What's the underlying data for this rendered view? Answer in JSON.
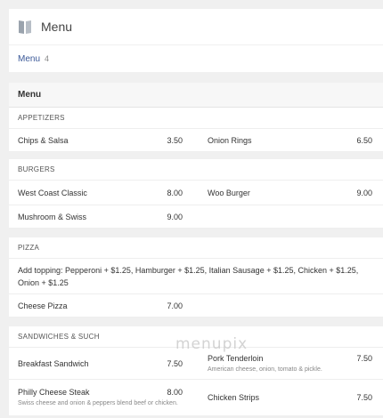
{
  "header": {
    "title": "Menu",
    "icon": "book-icon"
  },
  "breadcrumb": {
    "link": "Menu",
    "count": "4"
  },
  "menu_heading": "Menu",
  "sections": {
    "appetizers": {
      "title": "APPETIZERS",
      "items": [
        {
          "name": "Chips & Salsa",
          "price": "3.50"
        },
        {
          "name": "Onion Rings",
          "price": "6.50"
        }
      ]
    },
    "burgers": {
      "title": "BURGERS",
      "items": [
        {
          "name": "West Coast Classic",
          "price": "8.00"
        },
        {
          "name": "Woo Burger",
          "price": "9.00"
        },
        {
          "name": "Mushroom & Swiss",
          "price": "9.00"
        }
      ]
    },
    "pizza": {
      "title": "PIZZA",
      "note": "Add topping: Pepperoni + $1.25, Hamburger + $1.25, Italian Sausage + $1.25, Chicken + $1.25, Onion + $1.25",
      "items": [
        {
          "name": "Cheese Pizza",
          "price": "7.00"
        }
      ]
    },
    "sandwiches": {
      "title": "SANDWICHES & SUCH",
      "items": [
        {
          "name": "Breakfast Sandwich",
          "price": "7.50",
          "desc": ""
        },
        {
          "name": "Pork Tenderloin",
          "price": "7.50",
          "desc": "American cheese, onion, tomato & pickle."
        },
        {
          "name": "Philly Cheese Steak",
          "price": "8.00",
          "desc": "Swiss cheese and onion & peppers blend beef or chicken."
        },
        {
          "name": "Chicken Strips",
          "price": "7.50",
          "desc": ""
        }
      ]
    }
  },
  "watermark": "menupix",
  "colors": {
    "link": "#3b5998",
    "background": "#f0f0f0",
    "panel": "#ffffff"
  }
}
